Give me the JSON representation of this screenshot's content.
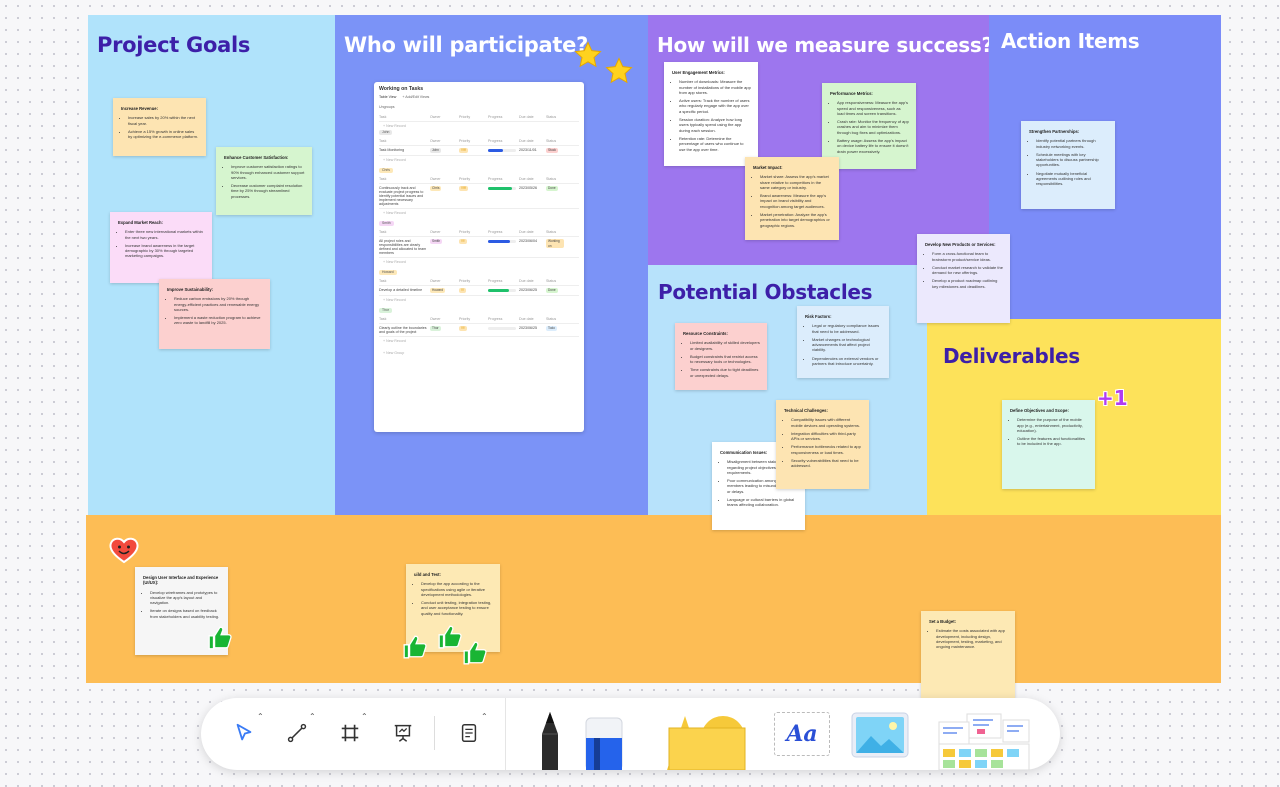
{
  "zones": {
    "project_goals": "Project Goals",
    "participants": "Who will participate?",
    "measure": "How will we measure success?",
    "action_items": "Action Items",
    "obstacles": "Potential Obstacles",
    "deliverables": "Deliverables"
  },
  "colors": {
    "sky": "#b0e3fb",
    "blue": "#7b93f7",
    "purple": "#9d76ee",
    "indigo": "#7b8cf8",
    "light_blue": "#b7e2fb",
    "yellow": "#fde25a",
    "orange": "#fdbd55",
    "title_dark": "#3d1fa8",
    "title_white": "#ffffff"
  },
  "notes": {
    "increase_revenue": {
      "title": "Increase Revenue:",
      "items": [
        "Increase sales by 20% within the next fiscal year.",
        "Achieve a 15% growth in online sales by optimizing the e-commerce platform."
      ]
    },
    "customer_satisfaction": {
      "title": "Enhance Customer Satisfaction:",
      "items": [
        "Improve customer satisfaction ratings to 90% through enhanced customer support services.",
        "Decrease customer complaint resolution time by 25% through streamlined processes."
      ]
    },
    "market_reach": {
      "title": "Expand Market Reach:",
      "items": [
        "Enter three new international markets within the next two years.",
        "Increase brand awareness in the target demographic by 30% through targeted marketing campaigns."
      ]
    },
    "sustainability": {
      "title": "Improve Sustainability:",
      "items": [
        "Reduce carbon emissions by 20% through energy-efficient practices and renewable energy sources.",
        "Implement a waste reduction program to achieve zero waste to landfill by 2025."
      ]
    },
    "user_engagement": {
      "title": "User Engagement Metrics:",
      "items": [
        "Number of downloads: Measure the number of installations of the mobile app from app stores.",
        "Active users: Track the number of users who regularly engage with the app over a specific period.",
        "Session duration: Analyze how long users typically spend using the app during each session.",
        "Retention rate: Determine the percentage of users who continue to use the app over time."
      ]
    },
    "performance": {
      "title": "Performance Metrics:",
      "items": [
        "App responsiveness: Measure the app's speed and responsiveness, such as load times and screen transitions.",
        "Crash rate: Monitor the frequency of app crashes and aim to minimize them through bug fixes and optimizations.",
        "Battery usage: Assess the app's impact on device battery life to ensure it doesn't drain power excessively."
      ]
    },
    "market_impact": {
      "title": "Market Impact:",
      "items": [
        "Market share: Assess the app's market share relative to competitors in the same category or industry.",
        "Brand awareness: Measure the app's impact on brand visibility and recognition among target audiences.",
        "Market penetration: Analyze the app's penetration into target demographics or geographic regions."
      ]
    },
    "strengthen_partnerships": {
      "title": "Strengthen Partnerships:",
      "items": [
        "Identify potential partners through industry networking events.",
        "Schedule meetings with key stakeholders to discuss partnership opportunities.",
        "Negotiate mutually beneficial agreements outlining roles and responsibilities."
      ]
    },
    "new_products": {
      "title": "Develop New Products or Services:",
      "items": [
        "Form a cross-functional team to brainstorm product/service ideas.",
        "Conduct market research to validate the demand for new offerings.",
        "Develop a product roadmap outlining key milestones and deadlines."
      ]
    },
    "resource_constraints": {
      "title": "Resource Constraints:",
      "items": [
        "Limited availability of skilled developers or designers.",
        "Budget constraints that restrict access to necessary tools or technologies.",
        "Time constraints due to tight deadlines or unexpected delays."
      ]
    },
    "risk_factors": {
      "title": "Risk Factors:",
      "items": [
        "Legal or regulatory compliance issues that need to be addressed.",
        "Market changes or technological advancements that affect project viability.",
        "Dependencies on external vendors or partners that introduce uncertainty."
      ]
    },
    "technical_challenges": {
      "title": "Technical Challenges:",
      "items": [
        "Compatibility issues with different mobile devices and operating systems.",
        "Integration difficulties with third-party APIs or services.",
        "Performance bottlenecks related to app responsiveness or load times.",
        "Security vulnerabilities that need to be addressed."
      ]
    },
    "communication_issues": {
      "title": "Communication Issues:",
      "items": [
        "Misalignment between stakeholders regarding project objectives or requirements.",
        "Poor communication among team members leading to misunderstandings or delays.",
        "Language or cultural barriers in global teams affecting collaboration."
      ]
    },
    "define_objectives": {
      "title": "Define Objectives and Scope:",
      "items": [
        "Determine the purpose of the mobile app (e.g., entertainment, productivity, education).",
        "Outline the features and functionalities to be included in the app."
      ]
    },
    "design_ui": {
      "title": "Design User Interface and Experience (UI/UX):",
      "items": [
        "Develop wireframes and prototypes to visualize the app's layout and navigation.",
        "Iterate on designs based on feedback from stakeholders and usability testing."
      ]
    },
    "build_test": {
      "title": "uild and Test:",
      "items": [
        "Develop the app according to the specifications using agile or iterative development methodologies.",
        "Conduct unit testing, integration testing, and user acceptance testing to ensure quality and functionality."
      ]
    },
    "set_budget": {
      "title": "Set a Budget:",
      "items": [
        "Estimate the costs associated with app development, including design, development, testing, marketing, and ongoing maintenance."
      ]
    }
  },
  "task_card": {
    "title": "Working on Tasks",
    "views": [
      "Table View",
      "+ Add/Edit Views"
    ],
    "ungroup": "Ungroups",
    "headers": [
      "Task",
      "Owner",
      "Priority",
      "Progress",
      "Due date",
      "Status"
    ],
    "new_record": "+ New Record",
    "new_group": "+ New Group",
    "groups": [
      {
        "tag": "John",
        "task": "Task Monitoring",
        "owner": "John",
        "priority": "!!!!!!",
        "progress": 0.55,
        "due": "2023/11/01",
        "status": "Stuck"
      },
      {
        "tag": "Chris",
        "task": "Continuously track and evaluate project progress to identify potential issues and implement necessary adjustments",
        "owner": "Chris",
        "priority": "!!!!!!",
        "progress": 0.85,
        "due": "2023/05/26",
        "status": "Done"
      },
      {
        "tag": "Smith",
        "task": "All project roles and responsibilities are clearly defined and allocated to team members",
        "owner": "Smith",
        "priority": "!!!!",
        "progress": 0.8,
        "due": "2023/06/04",
        "status": "Working on"
      },
      {
        "tag": "Howard",
        "task": "Develop a detailed timeline",
        "owner": "Howard",
        "priority": "!!!",
        "progress": 0.75,
        "due": "2023/06/25",
        "status": "Done"
      },
      {
        "tag": "Thor",
        "task": "Clearly outline the boundaries and goals of the project",
        "owner": "Thor",
        "priority": "!!!!",
        "progress": 0.0,
        "due": "2023/06/25",
        "status": "Todo"
      }
    ]
  },
  "stickers": {
    "plus_one": "+1"
  },
  "toolbar": {
    "text_tool_label": "Aa"
  }
}
